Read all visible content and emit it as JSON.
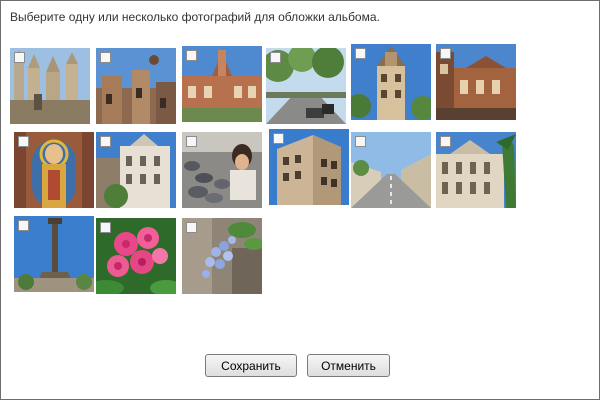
{
  "dialog": {
    "prompt": "Выберите одну или несколько фотографий для обложки альбома."
  },
  "photos": [
    {
      "id": "sagrada-familia",
      "checked": false
    },
    {
      "id": "modernist-facade",
      "checked": false
    },
    {
      "id": "hospital-sant-pau",
      "checked": false
    },
    {
      "id": "tree-lined-avenue",
      "checked": false
    },
    {
      "id": "corner-tower-building",
      "checked": false
    },
    {
      "id": "brick-tower-building",
      "checked": false
    },
    {
      "id": "saint-mosaic",
      "checked": false
    },
    {
      "id": "ornate-white-building",
      "checked": false
    },
    {
      "id": "pigeons-and-child",
      "checked": false
    },
    {
      "id": "tall-corner-building",
      "checked": false
    },
    {
      "id": "wide-boulevard",
      "checked": false
    },
    {
      "id": "classical-palace",
      "checked": false
    },
    {
      "id": "columbus-monument",
      "checked": false
    },
    {
      "id": "pink-flowers",
      "checked": false
    },
    {
      "id": "blue-flowers",
      "checked": false
    }
  ],
  "buttons": {
    "save": "Сохранить",
    "cancel": "Отменить"
  }
}
